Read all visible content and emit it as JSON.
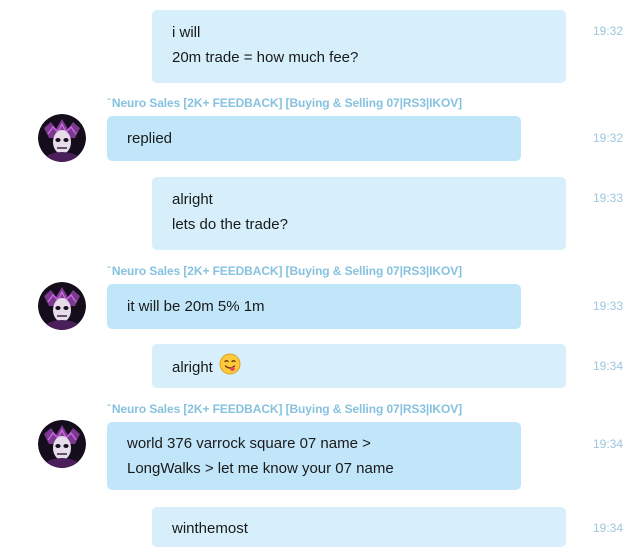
{
  "messages": [
    {
      "lines": [
        "i will",
        "20m trade = how much fee?"
      ],
      "time": "19:32"
    },
    {
      "sender": "Neuro Sales [2K+ FEEDBACK] [Buying & Selling 07|RS3|IKOV]",
      "lines": [
        "replied"
      ],
      "time": "19:32"
    },
    {
      "lines": [
        "alright",
        "lets do the trade?"
      ],
      "time": "19:33"
    },
    {
      "sender": "Neuro Sales [2K+ FEEDBACK] [Buying & Selling 07|RS3|IKOV]",
      "lines": [
        "it will be 20m 5% 1m"
      ],
      "time": "19:33"
    },
    {
      "lines": [
        "alright"
      ],
      "emoji": "face-savouring-icon",
      "time": "19:34"
    },
    {
      "sender": "Neuro Sales [2K+ FEEDBACK] [Buying & Selling 07|RS3|IKOV]",
      "lines": [
        "world 376 varrock square 07 name >",
        "LongWalks > let me know your 07 name"
      ],
      "time": "19:34"
    },
    {
      "lines": [
        "winthemost"
      ],
      "time": "19:34"
    }
  ],
  "colors": {
    "outgoing_bubble": "#d6effb",
    "incoming_bubble": "#c2e6f9",
    "timestamp": "#9ec6dd",
    "sender_name": "#86c2df"
  }
}
